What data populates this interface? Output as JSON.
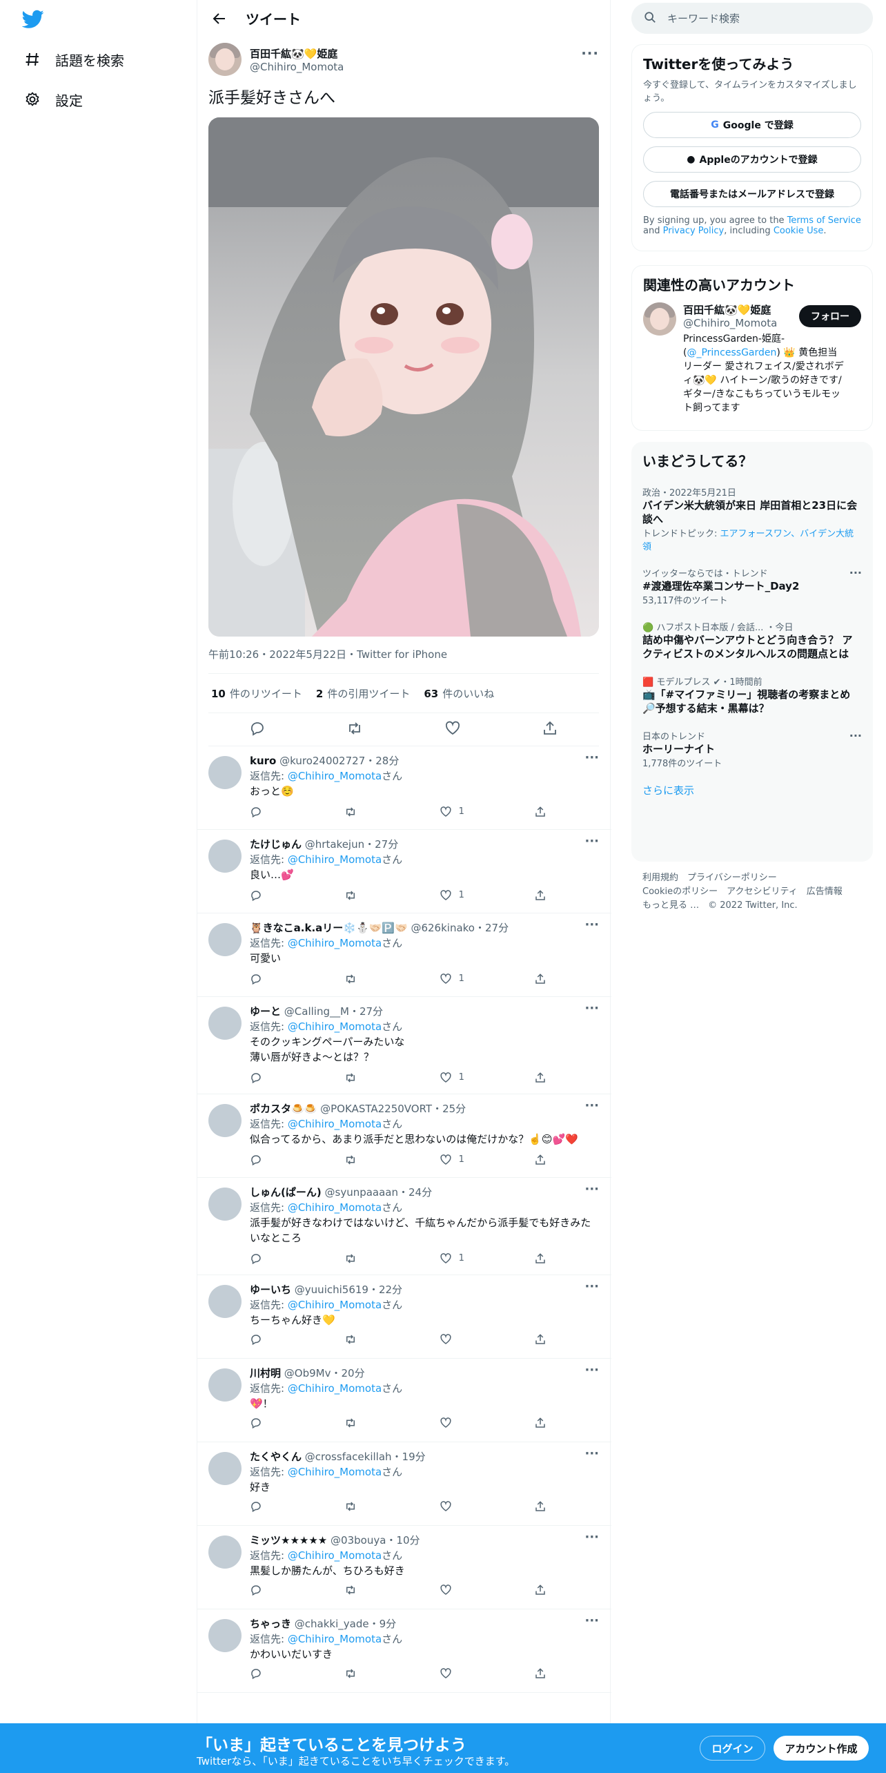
{
  "colors": {
    "accent": "#1d9bf0",
    "text": "#0f1419",
    "muted": "#536471",
    "follow_bg": "#0f1419"
  },
  "nav": {
    "logo_icon": "twitter-bird-icon",
    "explore": "話題を検索",
    "settings": "設定"
  },
  "header": {
    "title": "ツイート"
  },
  "tweet": {
    "name": "百田千紘🐼💛姫庭",
    "handle": "@Chihiro_Momota",
    "text": "派手髪好きさんへ",
    "meta": "午前10:26・2022年5月22日・Twitter for iPhone",
    "retweets_count": "10",
    "retweets_label": "件のリツイート",
    "quotes_count": "2",
    "quotes_label": "件の引用ツイート",
    "likes_count": "63",
    "likes_label": "件のいいね"
  },
  "replies": [
    {
      "name": "kuro",
      "handle": "@kuro24002727",
      "time": "・28分",
      "to_prefix": "返信先: ",
      "to": "@Chihiro_Momota",
      "to_suffix": "さん",
      "text": "おっと☺️",
      "likes": "1"
    },
    {
      "name": "たけじゅん",
      "handle": "@hrtakejun",
      "time": "・27分",
      "to_prefix": "返信先: ",
      "to": "@Chihiro_Momota",
      "to_suffix": "さん",
      "text": "良い…💕",
      "likes": "1"
    },
    {
      "name": "🦉きなこa.k.aリー❄️⛄️🤝🏻🅿️🤝🏻",
      "handle": "@626kinako",
      "time": "・27分",
      "to_prefix": "返信先: ",
      "to": "@Chihiro_Momota",
      "to_suffix": "さん",
      "text": "可愛い",
      "likes": "1"
    },
    {
      "name": "ゆーと",
      "handle": "@Calling__M",
      "time": "・27分",
      "to_prefix": "返信先: ",
      "to": "@Chihiro_Momota",
      "to_suffix": "さん",
      "text": "そのクッキングペーパーみたいな\n薄い唇が好きよ～とは？？",
      "likes": "1"
    },
    {
      "name": "ポカスタ🍮🍮",
      "handle": "@POKASTA2250VORT",
      "time": "・25分",
      "to_prefix": "返信先: ",
      "to": "@Chihiro_Momota",
      "to_suffix": "さん",
      "text": "似合ってるから、あまり派手だと思わないのは俺だけかな？☝️😊💕❤️",
      "likes": "1"
    },
    {
      "name": "しゅん(ぱーん)",
      "handle": "@syunpaaaan",
      "time": "・24分",
      "to_prefix": "返信先: ",
      "to": "@Chihiro_Momota",
      "to_suffix": "さん",
      "text": "派手髪が好きなわけではないけど、千紘ちゃんだから派手髪でも好きみたいなところ",
      "likes": "1"
    },
    {
      "name": "ゆーいち",
      "handle": "@yuuichi5619",
      "time": "・22分",
      "to_prefix": "返信先: ",
      "to": "@Chihiro_Momota",
      "to_suffix": "さん",
      "text": "ちーちゃん好き💛",
      "likes": ""
    },
    {
      "name": "川村明",
      "handle": "@Ob9Mv",
      "time": "・20分",
      "to_prefix": "返信先: ",
      "to": "@Chihiro_Momota",
      "to_suffix": "さん",
      "text": "💖！",
      "likes": ""
    },
    {
      "name": "たくやくん",
      "handle": "@crossfacekillah",
      "time": "・19分",
      "to_prefix": "返信先: ",
      "to": "@Chihiro_Momota",
      "to_suffix": "さん",
      "text": "好き",
      "likes": ""
    },
    {
      "name": "ミッツ★★★★★",
      "handle": "@03bouya",
      "time": "・10分",
      "to_prefix": "返信先: ",
      "to": "@Chihiro_Momota",
      "to_suffix": "さん",
      "text": "黒髪しか勝たんが、ちひろも好き",
      "likes": ""
    },
    {
      "name": "ちゃっき",
      "handle": "@chakki_yade",
      "time": "・9分",
      "to_prefix": "返信先: ",
      "to": "@Chihiro_Momota",
      "to_suffix": "さん",
      "text": "かわいいだいすき",
      "likes": ""
    }
  ],
  "search": {
    "placeholder": "キーワード検索"
  },
  "signup": {
    "title": "Twitterを使ってみよう",
    "desc": "今すぐ登録して、タイムラインをカスタマイズしましょう。",
    "google": "Google で登録",
    "apple": "Appleのアカウントで登録",
    "phone": "電話番号またはメールアドレスで登録",
    "terms_1": "By signing up, you agree to the ",
    "terms_link1": "Terms of Service",
    "terms_2": " and ",
    "terms_link2": "Privacy Policy",
    "terms_3": ", including ",
    "terms_link3": "Cookie Use",
    "terms_4": "."
  },
  "related": {
    "title": "関連性の高いアカウント",
    "name": "百田千紘🐼💛姫庭",
    "handle": "@Chihiro_Momota",
    "follow": "フォロー",
    "bio_1": "PrincessGarden-姫庭- (",
    "bio_link": "@_PrincessGarden",
    "bio_2": ") 👑 黄色担当 リーダー 愛されフェイス/愛されボディ🐼💛 ハイトーン/歌うの好きです/ギター/きなこもちっていうモルモット飼ってます"
  },
  "trends": {
    "title": "いまどうしてる？",
    "items": [
      {
        "context": "政治・2022年5月21日",
        "title": "バイデン米大統領が来日 岸田首相と23日に会談へ",
        "sub_label": "トレンドトピック: ",
        "sub_link": "エアフォースワン、バイデン大統領"
      },
      {
        "context": "ツイッターならでは・トレンド",
        "title": "#渡邉理佐卒業コンサート_Day2",
        "sub": "53,117件のツイート"
      },
      {
        "context": "🟢 ハフポスト日本版 / 会話...  ・今日",
        "title": "詰め中傷やバーンアウトとどう向き合う？ アクティビストのメンタルヘルスの問題点とは"
      },
      {
        "context": "🟥 モデルプレス ✔・1時間前",
        "title": "📺「#マイファミリー」視聴者の考察まとめ🔎予想する結末・黒幕は？"
      },
      {
        "context": "日本のトレンド",
        "title": "ホーリーナイト",
        "sub": "1,778件のツイート"
      }
    ],
    "more": "さらに表示"
  },
  "footer": {
    "line1": "利用規約　プライバシーポリシー",
    "line2": "Cookieのポリシー　アクセシビリティ　広告情報",
    "line3": "もっと見る …　© 2022 Twitter, Inc."
  },
  "bottom": {
    "title": "「いま」起きていることを見つけよう",
    "sub": "Twitterなら、「いま」起きていることをいち早くチェックできます。",
    "login": "ログイン",
    "signup": "アカウント作成"
  }
}
